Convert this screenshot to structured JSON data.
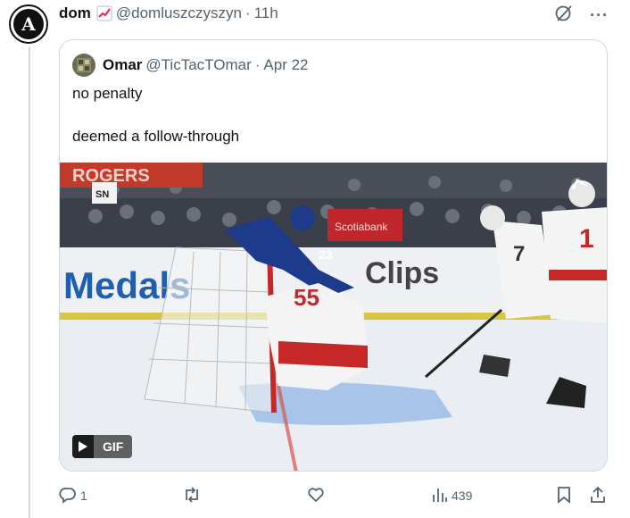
{
  "post": {
    "author_name": "dom",
    "author_emoji": "chart-increasing-icon",
    "author_handle": "@domluszczyszyn",
    "separator": "·",
    "timestamp": "11h",
    "more_label": "···"
  },
  "quote": {
    "author_name": "Omar",
    "author_handle": "@TicTacTOmar",
    "separator": "·",
    "date": "Apr 22",
    "text_line1": "no penalty",
    "text_line2": "deemed a follow-through",
    "media": {
      "type": "gif",
      "badge_label": "GIF",
      "board_text_left": "Medals",
      "board_text_right": "Clips",
      "board_sign": "Scotiabank",
      "banner_text": "ROGERS",
      "broadcaster_logo": "SN",
      "jersey_number_blue": "23",
      "jersey_number_red_left": "55",
      "jersey_number_red_mid": "7",
      "jersey_number_red_right": "1"
    }
  },
  "actions": {
    "reply_count": "1",
    "retweet_count": "",
    "like_count": "",
    "views_count": "439"
  },
  "colors": {
    "text_primary": "#0f1419",
    "text_secondary": "#536471",
    "border": "#cfd9de",
    "grok_icon": "#1d9bf0"
  }
}
